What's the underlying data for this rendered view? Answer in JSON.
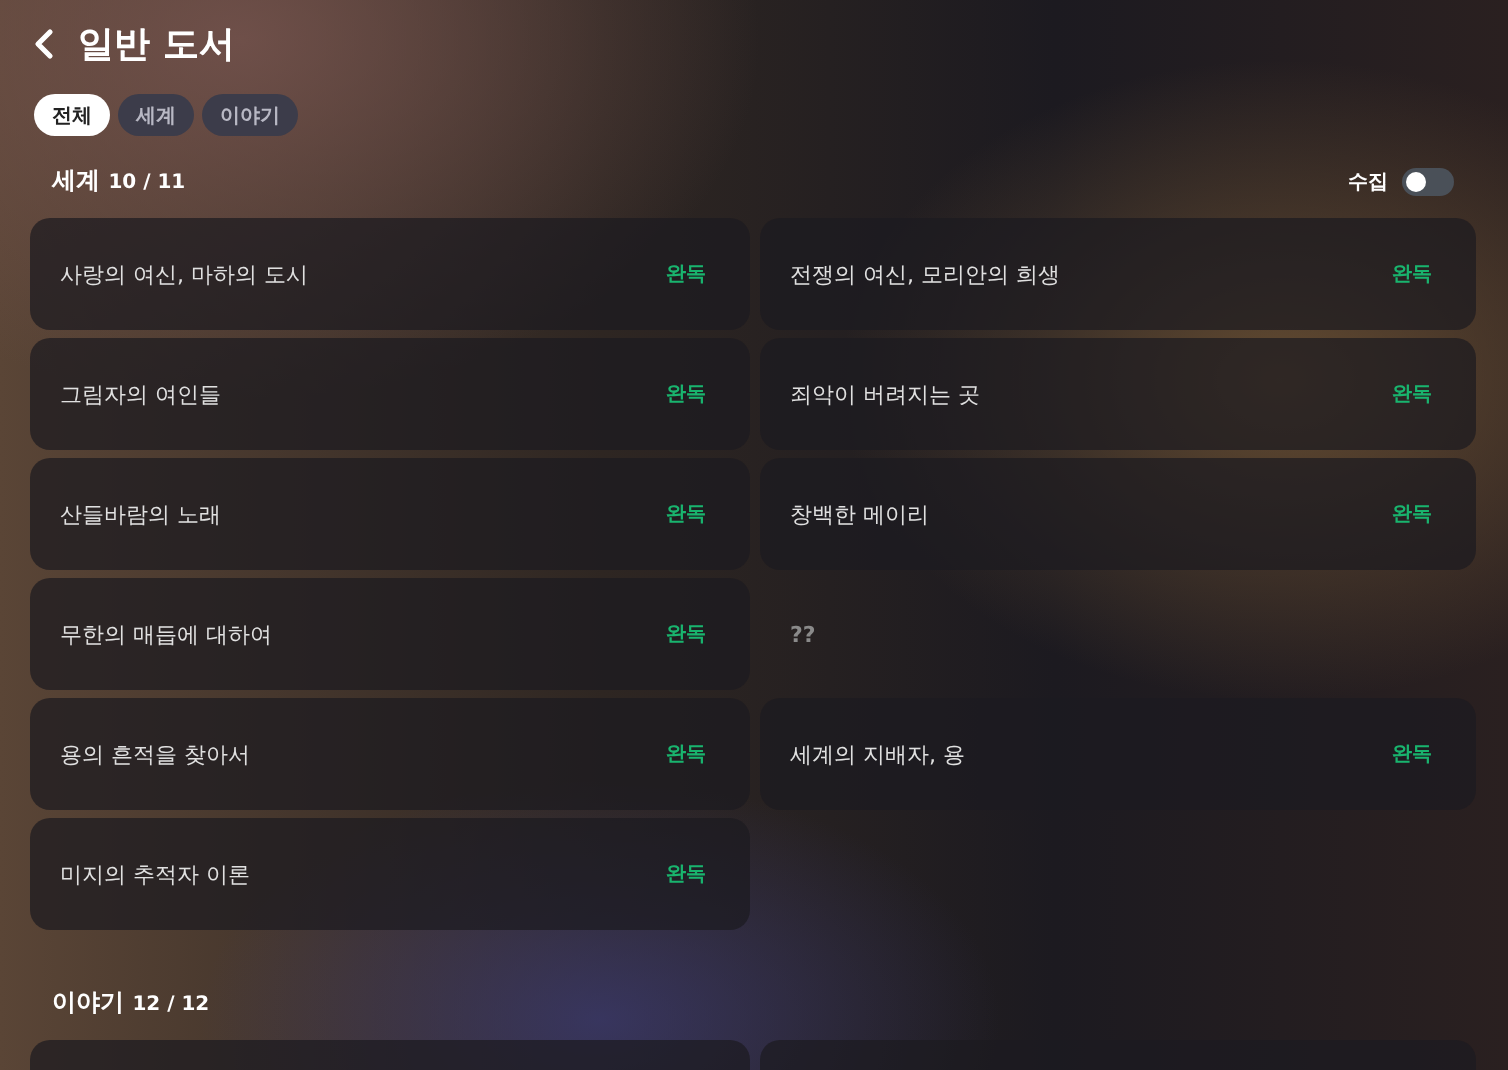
{
  "header": {
    "title": "일반 도서"
  },
  "filters": [
    {
      "label": "전체",
      "selected": true
    },
    {
      "label": "세계",
      "selected": false
    },
    {
      "label": "이야기",
      "selected": false
    }
  ],
  "sections": [
    {
      "title": "세계",
      "count": "10 / 11",
      "collect_toggle": {
        "label": "수집",
        "on": false
      },
      "items": [
        {
          "title": "사랑의 여신, 마하의 도시",
          "status": "완독",
          "locked": false
        },
        {
          "title": "전쟁의 여신, 모리안의 희생",
          "status": "완독",
          "locked": false
        },
        {
          "title": "그림자의 여인들",
          "status": "완독",
          "locked": false
        },
        {
          "title": "죄악이 버려지는 곳",
          "status": "완독",
          "locked": false
        },
        {
          "title": "산들바람의 노래",
          "status": "완독",
          "locked": false
        },
        {
          "title": "창백한 메이리",
          "status": "완독",
          "locked": false
        },
        {
          "title": "무한의 매듭에 대하여",
          "status": "완독",
          "locked": false
        },
        {
          "title": "??",
          "locked": true
        },
        {
          "title": "용의 흔적을 찾아서",
          "status": "완독",
          "locked": false
        },
        {
          "title": "세계의 지배자, 용",
          "status": "완독",
          "locked": false
        },
        {
          "title": "미지의 추적자 이론",
          "status": "완독",
          "locked": false
        }
      ]
    },
    {
      "title": "이야기",
      "count": "12 / 12"
    }
  ]
}
